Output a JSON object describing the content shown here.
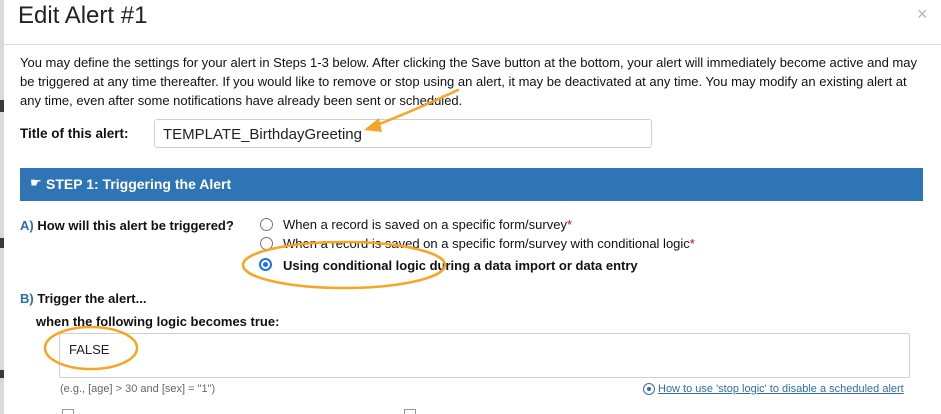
{
  "modal": {
    "title": "Edit Alert #1",
    "close_glyph": "×"
  },
  "intro_text": "You may define the settings for your alert in Steps 1-3 below. After clicking the Save button at the bottom, your alert will immediately become active and may be triggered at any time thereafter. If you would like to remove or stop using an alert, it may be deactivated at any time. You may modify an existing alert at any time, even after some notifications have already been sent or scheduled.",
  "alert_title": {
    "label": "Title of this alert:",
    "value": "TEMPLATE_BirthdayGreeting"
  },
  "step1": {
    "icon": "hand-pointing-icon",
    "label": "STEP 1: Triggering the Alert"
  },
  "question_a": {
    "letter": "A)",
    "label": "How will this alert be triggered?",
    "options": [
      {
        "label": "When a record is saved on a specific form/survey",
        "required_mark": "*",
        "selected": false
      },
      {
        "label": "When a record is saved on a specific form/survey with conditional logic",
        "required_mark": "*",
        "selected": false
      },
      {
        "label": "Using conditional logic during a data import or data entry",
        "required_mark": "",
        "selected": true
      }
    ]
  },
  "question_b": {
    "letter": "B)",
    "label": "Trigger the alert...",
    "sub_label": "when the following logic becomes true:",
    "logic_value": "FALSE",
    "example": "(e.g., [age] > 30 and [sex] = \"1\")",
    "help_link": "How to use 'stop logic' to disable a scheduled alert"
  },
  "colors": {
    "step_bar": "#2f74b5",
    "radio_selected": "#1a73e8",
    "annotation": "#f5a623",
    "required": "#d0021b",
    "link": "#2f6ea9"
  }
}
